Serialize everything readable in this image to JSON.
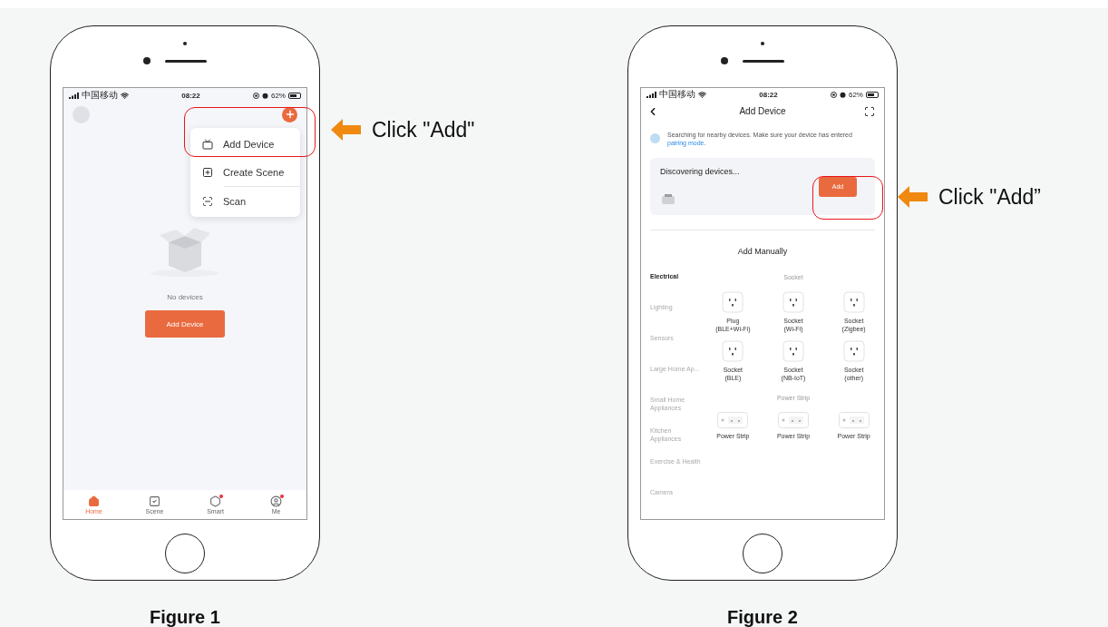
{
  "figure_1": {
    "status_bar": {
      "carrier": "中国移动",
      "time": "08:22",
      "battery": "62%"
    },
    "menu": [
      {
        "kind": "device",
        "label": "Add Device"
      },
      {
        "kind": "scene",
        "label": "Create Scene"
      },
      {
        "kind": "scan",
        "label": "Scan"
      }
    ],
    "empty_text": "No devices",
    "button": "Add Device",
    "tabs": [
      {
        "kind": "home",
        "label": "Home",
        "selected": true,
        "badge": false
      },
      {
        "kind": "scene",
        "label": "Scene",
        "selected": false,
        "badge": false
      },
      {
        "kind": "smart",
        "label": "Smart",
        "selected": false,
        "badge": true
      },
      {
        "kind": "me",
        "label": "Me",
        "selected": false,
        "badge": true
      }
    ],
    "callout": "Click \"Add\"",
    "caption": "Figure 1"
  },
  "figure_2": {
    "status_bar": {
      "carrier": "中国移动",
      "time": "08:22",
      "battery": "62%"
    },
    "title": "Add Device",
    "info_text": "Searching for nearby devices. Make sure your device has entered ",
    "info_link": "pairing mode",
    "info_end": ".",
    "discover_title": "Discovering devices...",
    "add_button": "Add",
    "manual_title": "Add Manually",
    "categories": [
      {
        "label": "Electrical",
        "selected": true
      },
      {
        "label": "Lighting",
        "selected": false
      },
      {
        "label": "Sensors",
        "selected": false
      },
      {
        "label": "Large Home Ap...",
        "selected": false
      },
      {
        "label": "Small Home Appliances",
        "selected": false
      },
      {
        "label": "Kitchen Appliances",
        "selected": false
      },
      {
        "label": "Exercise & Health",
        "selected": false
      },
      {
        "label": "Camera",
        "selected": false
      }
    ],
    "sections": [
      {
        "title": "Socket",
        "items": [
          {
            "kind": "socket",
            "name": "Plug",
            "sub": "(BLE+Wi-Fi)"
          },
          {
            "kind": "socket",
            "name": "Socket",
            "sub": "(Wi-Fi)"
          },
          {
            "kind": "socket",
            "name": "Socket",
            "sub": "(Zigbee)"
          },
          {
            "kind": "socket",
            "name": "Socket",
            "sub": "(BLE)"
          },
          {
            "kind": "socket",
            "name": "Socket",
            "sub": "(NB-IoT)"
          },
          {
            "kind": "socket",
            "name": "Socket",
            "sub": "(other)"
          }
        ]
      },
      {
        "title": "Power Strip",
        "items": [
          {
            "kind": "strip",
            "name": "Power Strip"
          },
          {
            "kind": "strip",
            "name": "Power Strip"
          },
          {
            "kind": "strip",
            "name": "Power Strip"
          }
        ]
      }
    ],
    "callout": "Click \"Add”",
    "caption": "Figure 2"
  }
}
